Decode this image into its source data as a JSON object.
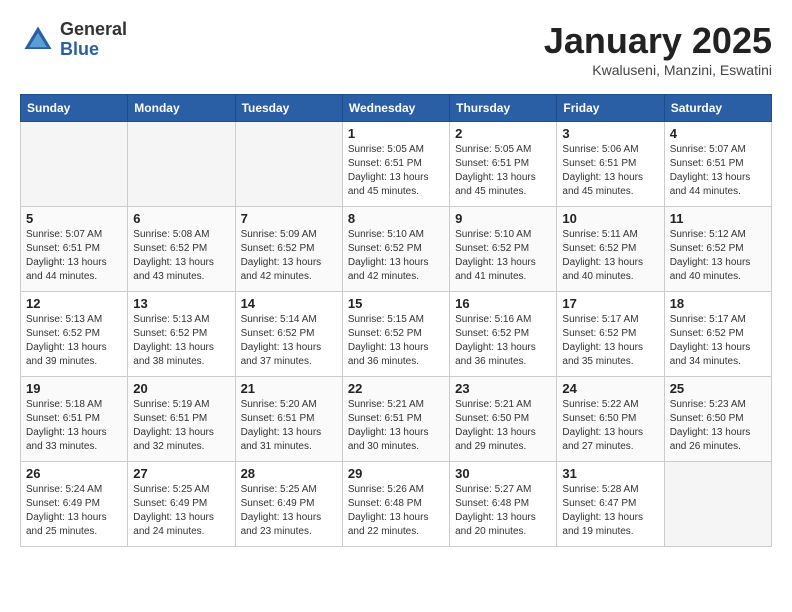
{
  "logo": {
    "general": "General",
    "blue": "Blue"
  },
  "title": "January 2025",
  "subtitle": "Kwaluseni, Manzini, Eswatini",
  "headers": [
    "Sunday",
    "Monday",
    "Tuesday",
    "Wednesday",
    "Thursday",
    "Friday",
    "Saturday"
  ],
  "weeks": [
    [
      {
        "day": "",
        "info": ""
      },
      {
        "day": "",
        "info": ""
      },
      {
        "day": "",
        "info": ""
      },
      {
        "day": "1",
        "info": "Sunrise: 5:05 AM\nSunset: 6:51 PM\nDaylight: 13 hours and 45 minutes."
      },
      {
        "day": "2",
        "info": "Sunrise: 5:05 AM\nSunset: 6:51 PM\nDaylight: 13 hours and 45 minutes."
      },
      {
        "day": "3",
        "info": "Sunrise: 5:06 AM\nSunset: 6:51 PM\nDaylight: 13 hours and 45 minutes."
      },
      {
        "day": "4",
        "info": "Sunrise: 5:07 AM\nSunset: 6:51 PM\nDaylight: 13 hours and 44 minutes."
      }
    ],
    [
      {
        "day": "5",
        "info": "Sunrise: 5:07 AM\nSunset: 6:51 PM\nDaylight: 13 hours and 44 minutes."
      },
      {
        "day": "6",
        "info": "Sunrise: 5:08 AM\nSunset: 6:52 PM\nDaylight: 13 hours and 43 minutes."
      },
      {
        "day": "7",
        "info": "Sunrise: 5:09 AM\nSunset: 6:52 PM\nDaylight: 13 hours and 42 minutes."
      },
      {
        "day": "8",
        "info": "Sunrise: 5:10 AM\nSunset: 6:52 PM\nDaylight: 13 hours and 42 minutes."
      },
      {
        "day": "9",
        "info": "Sunrise: 5:10 AM\nSunset: 6:52 PM\nDaylight: 13 hours and 41 minutes."
      },
      {
        "day": "10",
        "info": "Sunrise: 5:11 AM\nSunset: 6:52 PM\nDaylight: 13 hours and 40 minutes."
      },
      {
        "day": "11",
        "info": "Sunrise: 5:12 AM\nSunset: 6:52 PM\nDaylight: 13 hours and 40 minutes."
      }
    ],
    [
      {
        "day": "12",
        "info": "Sunrise: 5:13 AM\nSunset: 6:52 PM\nDaylight: 13 hours and 39 minutes."
      },
      {
        "day": "13",
        "info": "Sunrise: 5:13 AM\nSunset: 6:52 PM\nDaylight: 13 hours and 38 minutes."
      },
      {
        "day": "14",
        "info": "Sunrise: 5:14 AM\nSunset: 6:52 PM\nDaylight: 13 hours and 37 minutes."
      },
      {
        "day": "15",
        "info": "Sunrise: 5:15 AM\nSunset: 6:52 PM\nDaylight: 13 hours and 36 minutes."
      },
      {
        "day": "16",
        "info": "Sunrise: 5:16 AM\nSunset: 6:52 PM\nDaylight: 13 hours and 36 minutes."
      },
      {
        "day": "17",
        "info": "Sunrise: 5:17 AM\nSunset: 6:52 PM\nDaylight: 13 hours and 35 minutes."
      },
      {
        "day": "18",
        "info": "Sunrise: 5:17 AM\nSunset: 6:52 PM\nDaylight: 13 hours and 34 minutes."
      }
    ],
    [
      {
        "day": "19",
        "info": "Sunrise: 5:18 AM\nSunset: 6:51 PM\nDaylight: 13 hours and 33 minutes."
      },
      {
        "day": "20",
        "info": "Sunrise: 5:19 AM\nSunset: 6:51 PM\nDaylight: 13 hours and 32 minutes."
      },
      {
        "day": "21",
        "info": "Sunrise: 5:20 AM\nSunset: 6:51 PM\nDaylight: 13 hours and 31 minutes."
      },
      {
        "day": "22",
        "info": "Sunrise: 5:21 AM\nSunset: 6:51 PM\nDaylight: 13 hours and 30 minutes."
      },
      {
        "day": "23",
        "info": "Sunrise: 5:21 AM\nSunset: 6:50 PM\nDaylight: 13 hours and 29 minutes."
      },
      {
        "day": "24",
        "info": "Sunrise: 5:22 AM\nSunset: 6:50 PM\nDaylight: 13 hours and 27 minutes."
      },
      {
        "day": "25",
        "info": "Sunrise: 5:23 AM\nSunset: 6:50 PM\nDaylight: 13 hours and 26 minutes."
      }
    ],
    [
      {
        "day": "26",
        "info": "Sunrise: 5:24 AM\nSunset: 6:49 PM\nDaylight: 13 hours and 25 minutes."
      },
      {
        "day": "27",
        "info": "Sunrise: 5:25 AM\nSunset: 6:49 PM\nDaylight: 13 hours and 24 minutes."
      },
      {
        "day": "28",
        "info": "Sunrise: 5:25 AM\nSunset: 6:49 PM\nDaylight: 13 hours and 23 minutes."
      },
      {
        "day": "29",
        "info": "Sunrise: 5:26 AM\nSunset: 6:48 PM\nDaylight: 13 hours and 22 minutes."
      },
      {
        "day": "30",
        "info": "Sunrise: 5:27 AM\nSunset: 6:48 PM\nDaylight: 13 hours and 20 minutes."
      },
      {
        "day": "31",
        "info": "Sunrise: 5:28 AM\nSunset: 6:47 PM\nDaylight: 13 hours and 19 minutes."
      },
      {
        "day": "",
        "info": ""
      }
    ]
  ]
}
